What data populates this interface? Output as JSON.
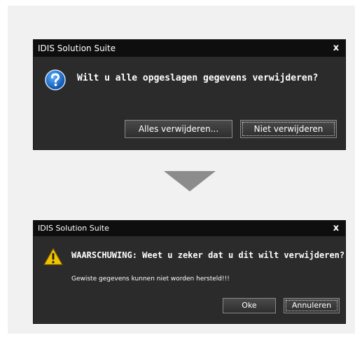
{
  "dialog1": {
    "title": "IDIS Solution Suite",
    "close_label": "x",
    "message": "Wilt u alle opgeslagen gegevens verwijderen?",
    "buttons": {
      "delete_all": "Alles verwijderen...",
      "not_delete": "Niet verwijderen"
    },
    "icon": "question-icon"
  },
  "dialog2": {
    "title": "IDIS Solution Suite",
    "close_label": "x",
    "message": "WAARSCHUWING: Weet u zeker dat u dit wilt verwijderen?",
    "submessage": "Gewiste gegevens kunnen niet worden hersteld!!!",
    "buttons": {
      "ok": "Oke",
      "cancel": "Annuleren"
    },
    "icon": "warning-icon"
  },
  "colors": {
    "panel_bg": "#f1f1f1",
    "dialog_bg": "#2b2b2b",
    "titlebar_bg": "#0e0e0e",
    "arrow": "#8c8c8c",
    "question_icon": "#1a73c8",
    "warning_icon": "#f2c300"
  }
}
